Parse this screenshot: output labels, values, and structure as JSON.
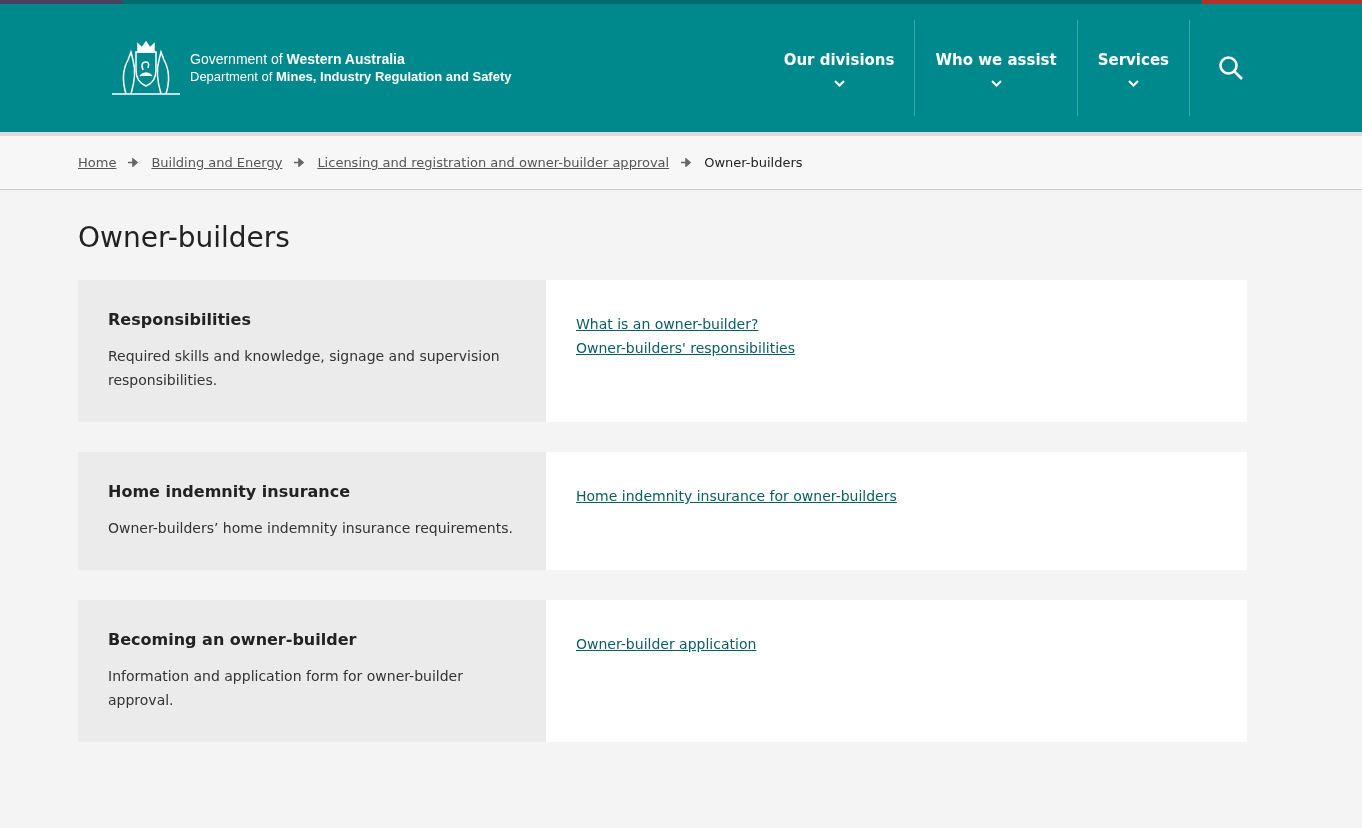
{
  "header": {
    "logo_line_1": "Government of **Western Australia**",
    "logo_line_2": "Department of **Mines, Industry Regulation and Safety**",
    "nav": [
      {
        "label": "Our divisions",
        "expanded": false
      },
      {
        "label": "Who we assist",
        "expanded": false
      },
      {
        "label": "Services",
        "expanded": false
      }
    ]
  },
  "breadcrumb": [
    {
      "label": "Home",
      "link": true
    },
    {
      "label": "Building and Energy",
      "link": true
    },
    {
      "label": "Licensing and registration and owner-builder approval",
      "link": true
    },
    {
      "label": "Owner-builders",
      "link": false
    }
  ],
  "page_title": "Owner-builders",
  "sections": [
    {
      "title": "Responsibilities",
      "description": "Required skills and knowledge, signage and supervision responsibilities.",
      "links": [
        "What is an owner-builder?",
        "Owner-builders' responsibilities"
      ]
    },
    {
      "title": "Home indemnity insurance",
      "description": "Owner-builders’ home indemnity insurance requirements.",
      "links": [
        "Home indemnity insurance for owner-builders"
      ]
    },
    {
      "title": "Becoming an owner-builder",
      "description": "Information and application form for owner-builder approval.",
      "links": [
        "Owner-builder application"
      ]
    }
  ]
}
